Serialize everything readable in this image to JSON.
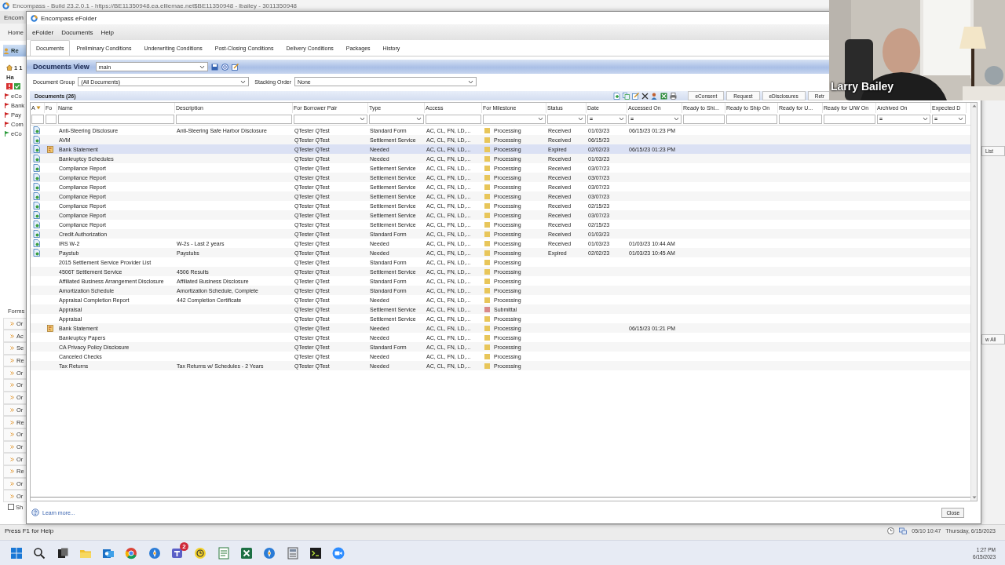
{
  "app": {
    "title": "Encompass - Build 23.2.0.1 - https://BE11350948.ea.elliemae.net$BE11350948 - lbailey - 3011350948",
    "menu": "Encom",
    "nav": "Home",
    "sidebar": {
      "header": "Re",
      "loan": "1 1",
      "loan_sub": "Ha",
      "alerts": [
        {
          "label": "eCo",
          "color": "#cc2222"
        },
        {
          "label": "Bank",
          "color": "#cc2222"
        },
        {
          "label": "Pay",
          "color": "#cc2222"
        },
        {
          "label": "Com",
          "color": "#cc2222"
        },
        {
          "label": "eCo",
          "color": "#2a9a3a"
        }
      ]
    },
    "forms_title": "Forms",
    "forms": [
      "Or",
      "Ac",
      "Se",
      "Re",
      "Or",
      "Or",
      "Or",
      "Or",
      "Re",
      "Or",
      "Or",
      "Or",
      "Re",
      "Or",
      "Or"
    ],
    "show_checkbox": {
      "label": "Sh",
      "checked": false
    },
    "right_buttons": [
      "List",
      "w All"
    ]
  },
  "efolder": {
    "title": "Encompass eFolder",
    "menu": [
      "eFolder",
      "Documents",
      "Help"
    ],
    "tabs": [
      {
        "label": "Documents",
        "selected": true
      },
      {
        "label": "Preliminary Conditions",
        "selected": false
      },
      {
        "label": "Underwriting Conditions",
        "selected": false
      },
      {
        "label": "Post-Closing Conditions",
        "selected": false
      },
      {
        "label": "Delivery Conditions",
        "selected": false
      },
      {
        "label": "Packages",
        "selected": false
      },
      {
        "label": "History",
        "selected": false
      }
    ],
    "view": {
      "label": "Documents View",
      "value": "main"
    },
    "document_group": {
      "label": "Document Group",
      "value": "(All Documents)"
    },
    "stacking_order": {
      "label": "Stacking Order",
      "value": "None"
    },
    "documents_title": "Documents (26)",
    "actions": [
      "eConsent",
      "Request",
      "eDisclosures",
      "Retr"
    ],
    "columns": [
      {
        "label": "A",
        "sorted": true,
        "filter": {
          "kind": "text"
        }
      },
      {
        "label": "Fo",
        "sorted": false,
        "filter": {
          "kind": "text"
        }
      },
      {
        "label": "Name",
        "sorted": false,
        "filter": {
          "kind": "text"
        }
      },
      {
        "label": "Description",
        "sorted": false,
        "filter": {
          "kind": "text"
        }
      },
      {
        "label": "For Borrower Pair",
        "sorted": false,
        "filter": {
          "kind": "select"
        }
      },
      {
        "label": "Type",
        "sorted": false,
        "filter": {
          "kind": "select"
        }
      },
      {
        "label": "Access",
        "sorted": false,
        "filter": {
          "kind": "text"
        }
      },
      {
        "label": "For Milestone",
        "sorted": false,
        "filter": {
          "kind": "select"
        }
      },
      {
        "label": "Status",
        "sorted": false,
        "filter": {
          "kind": "select"
        }
      },
      {
        "label": "Date",
        "sorted": false,
        "filter": {
          "kind": "operator",
          "value": "="
        }
      },
      {
        "label": "Accessed On",
        "sorted": false,
        "filter": {
          "kind": "operator",
          "value": "="
        }
      },
      {
        "label": "Ready to Shi...",
        "sorted": false,
        "filter": {
          "kind": "text"
        }
      },
      {
        "label": "Ready to Ship On",
        "sorted": false,
        "filter": {
          "kind": "text"
        }
      },
      {
        "label": "Ready for U...",
        "sorted": false,
        "filter": {
          "kind": "text"
        }
      },
      {
        "label": "Ready for U/W On",
        "sorted": false,
        "filter": {
          "kind": "text"
        }
      },
      {
        "label": "Archived On",
        "sorted": false,
        "filter": {
          "kind": "operator",
          "value": "="
        }
      },
      {
        "label": "Expected D",
        "sorted": false,
        "filter": {
          "kind": "operator",
          "value": "="
        }
      }
    ],
    "rows": [
      {
        "has_file": true,
        "flagged": false,
        "selected": false,
        "name": "Anti-Steering Disclosure",
        "description": "Anti-Steering Safe Harbor Disclosure",
        "borrower": "QTester QTest",
        "type": "Standard Form",
        "access": "AC, CL, FN, LD,...",
        "milestone": "Processing",
        "color": "#e8c65a",
        "status": "Received",
        "date": "01/03/23",
        "accessed_on": "06/15/23 01:23 PM"
      },
      {
        "has_file": true,
        "flagged": false,
        "selected": false,
        "name": "AVM",
        "borrower": "QTester QTest",
        "type": "Settlement Service",
        "access": "AC, CL, FN, LD,...",
        "milestone": "Processing",
        "color": "#e8c65a",
        "status": "Received",
        "date": "06/15/23"
      },
      {
        "has_file": true,
        "flagged": true,
        "selected": true,
        "name": "Bank Statement",
        "borrower": "QTester QTest",
        "type": "Needed",
        "access": "AC, CL, FN, LD,...",
        "milestone": "Processing",
        "color": "#e8c65a",
        "status": "Expired",
        "date": "02/02/23",
        "accessed_on": "06/15/23 01:23 PM"
      },
      {
        "has_file": true,
        "flagged": false,
        "selected": false,
        "name": "Bankruptcy Schedules",
        "borrower": "QTester QTest",
        "type": "Needed",
        "access": "AC, CL, FN, LD,...",
        "milestone": "Processing",
        "color": "#e8c65a",
        "status": "Received",
        "date": "01/03/23"
      },
      {
        "has_file": true,
        "flagged": false,
        "selected": false,
        "name": "Compliance Report",
        "borrower": "QTester QTest",
        "type": "Settlement Service",
        "access": "AC, CL, FN, LD,...",
        "milestone": "Processing",
        "color": "#e8c65a",
        "status": "Received",
        "date": "03/07/23"
      },
      {
        "has_file": true,
        "flagged": false,
        "selected": false,
        "name": "Compliance Report",
        "borrower": "QTester QTest",
        "type": "Settlement Service",
        "access": "AC, CL, FN, LD,...",
        "milestone": "Processing",
        "color": "#e8c65a",
        "status": "Received",
        "date": "03/07/23"
      },
      {
        "has_file": true,
        "flagged": false,
        "selected": false,
        "name": "Compliance Report",
        "borrower": "QTester QTest",
        "type": "Settlement Service",
        "access": "AC, CL, FN, LD,...",
        "milestone": "Processing",
        "color": "#e8c65a",
        "status": "Received",
        "date": "03/07/23"
      },
      {
        "has_file": true,
        "flagged": false,
        "selected": false,
        "name": "Compliance Report",
        "borrower": "QTester QTest",
        "type": "Settlement Service",
        "access": "AC, CL, FN, LD,...",
        "milestone": "Processing",
        "color": "#e8c65a",
        "status": "Received",
        "date": "03/07/23"
      },
      {
        "has_file": true,
        "flagged": false,
        "selected": false,
        "name": "Compliance Report",
        "borrower": "QTester QTest",
        "type": "Settlement Service",
        "access": "AC, CL, FN, LD,...",
        "milestone": "Processing",
        "color": "#e8c65a",
        "status": "Received",
        "date": "02/15/23"
      },
      {
        "has_file": true,
        "flagged": false,
        "selected": false,
        "name": "Compliance Report",
        "borrower": "QTester QTest",
        "type": "Settlement Service",
        "access": "AC, CL, FN, LD,...",
        "milestone": "Processing",
        "color": "#e8c65a",
        "status": "Received",
        "date": "03/07/23"
      },
      {
        "has_file": true,
        "flagged": false,
        "selected": false,
        "name": "Compliance Report",
        "borrower": "QTester QTest",
        "type": "Settlement Service",
        "access": "AC, CL, FN, LD,...",
        "milestone": "Processing",
        "color": "#e8c65a",
        "status": "Received",
        "date": "02/15/23"
      },
      {
        "has_file": true,
        "flagged": false,
        "selected": false,
        "name": "Credit Authorization",
        "borrower": "QTester QTest",
        "type": "Standard Form",
        "access": "AC, CL, FN, LD,...",
        "milestone": "Processing",
        "color": "#e8c65a",
        "status": "Received",
        "date": "01/03/23"
      },
      {
        "has_file": true,
        "flagged": false,
        "selected": false,
        "name": "IRS W-2",
        "description": "W-2s - Last 2 years",
        "borrower": "QTester QTest",
        "type": "Needed",
        "access": "AC, CL, FN, LD,...",
        "milestone": "Processing",
        "color": "#e8c65a",
        "status": "Received",
        "date": "01/03/23",
        "accessed_on": "01/03/23 10:44 AM"
      },
      {
        "has_file": true,
        "flagged": false,
        "selected": false,
        "name": "Paystub",
        "description": "Paystubs",
        "borrower": "QTester QTest",
        "type": "Needed",
        "access": "AC, CL, FN, LD,...",
        "milestone": "Processing",
        "color": "#e8c65a",
        "status": "Expired",
        "date": "02/02/23",
        "accessed_on": "01/03/23 10:45 AM"
      },
      {
        "has_file": false,
        "flagged": false,
        "selected": false,
        "name": "2015 Settlement Service Provider List",
        "borrower": "QTester QTest",
        "type": "Standard Form",
        "access": "AC, CL, FN, LD,...",
        "milestone": "Processing",
        "color": "#e8c65a"
      },
      {
        "has_file": false,
        "flagged": false,
        "selected": false,
        "name": "4506T Settlement Service",
        "description": "4506 Results",
        "borrower": "QTester QTest",
        "type": "Settlement Service",
        "access": "AC, CL, FN, LD,...",
        "milestone": "Processing",
        "color": "#e8c65a"
      },
      {
        "has_file": false,
        "flagged": false,
        "selected": false,
        "name": "Affiliated Business Arrangement Disclosure",
        "description": "Affiliated Business Disclosure",
        "borrower": "QTester QTest",
        "type": "Standard Form",
        "access": "AC, CL, FN, LD,...",
        "milestone": "Processing",
        "color": "#e8c65a"
      },
      {
        "has_file": false,
        "flagged": false,
        "selected": false,
        "name": "Amortization Schedule",
        "description": "Amortization Schedule, Complete",
        "borrower": "QTester QTest",
        "type": "Standard Form",
        "access": "AC, CL, FN, LD,...",
        "milestone": "Processing",
        "color": "#e8c65a"
      },
      {
        "has_file": false,
        "flagged": false,
        "selected": false,
        "name": "Appraisal Completion Report",
        "description": "442 Completion Certificate",
        "borrower": "QTester QTest",
        "type": "Needed",
        "access": "AC, CL, FN, LD,...",
        "milestone": "Processing",
        "color": "#e8c65a"
      },
      {
        "has_file": false,
        "flagged": false,
        "selected": false,
        "name": "Appraisal",
        "borrower": "QTester QTest",
        "type": "Settlement Service",
        "access": "AC, CL, FN, LD,...",
        "milestone": "Submittal",
        "color": "#d98a8a"
      },
      {
        "has_file": false,
        "flagged": false,
        "selected": false,
        "name": "Appraisal",
        "borrower": "QTester QTest",
        "type": "Settlement Service",
        "access": "AC, CL, FN, LD,...",
        "milestone": "Processing",
        "color": "#e8c65a"
      },
      {
        "has_file": false,
        "flagged": true,
        "selected": false,
        "name": "Bank Statement",
        "borrower": "QTester QTest",
        "type": "Needed",
        "access": "AC, CL, FN, LD,...",
        "milestone": "Processing",
        "color": "#e8c65a",
        "accessed_on": "06/15/23 01:21 PM"
      },
      {
        "has_file": false,
        "flagged": false,
        "selected": false,
        "name": "Bankruptcy Papers",
        "borrower": "QTester QTest",
        "type": "Needed",
        "access": "AC, CL, FN, LD,...",
        "milestone": "Processing",
        "color": "#e8c65a"
      },
      {
        "has_file": false,
        "flagged": false,
        "selected": false,
        "name": "CA Privacy Policy Disclosure",
        "borrower": "QTester QTest",
        "type": "Standard Form",
        "access": "AC, CL, FN, LD,...",
        "milestone": "Processing",
        "color": "#e8c65a"
      },
      {
        "has_file": false,
        "flagged": false,
        "selected": false,
        "name": "Canceled Checks",
        "borrower": "QTester QTest",
        "type": "Needed",
        "access": "AC, CL, FN, LD,...",
        "milestone": "Processing",
        "color": "#e8c65a"
      },
      {
        "has_file": false,
        "flagged": false,
        "selected": false,
        "name": "Tax Returns",
        "description": "Tax Returns w/ Schedules - 2 Years",
        "borrower": "QTester QTest",
        "type": "Needed",
        "access": "AC, CL, FN, LD,...",
        "milestone": "Processing",
        "color": "#e8c65a"
      }
    ],
    "learn_more": "Learn more...",
    "close": "Close"
  },
  "status_bar": {
    "help": "Press F1 for Help",
    "session": "05/10 10:47",
    "date": "Thursday, 6/15/2023"
  },
  "taskbar": {
    "badge": "2",
    "time": "1:27 PM",
    "date": "6/15/2023"
  },
  "video": {
    "name": "Larry Bailey"
  }
}
